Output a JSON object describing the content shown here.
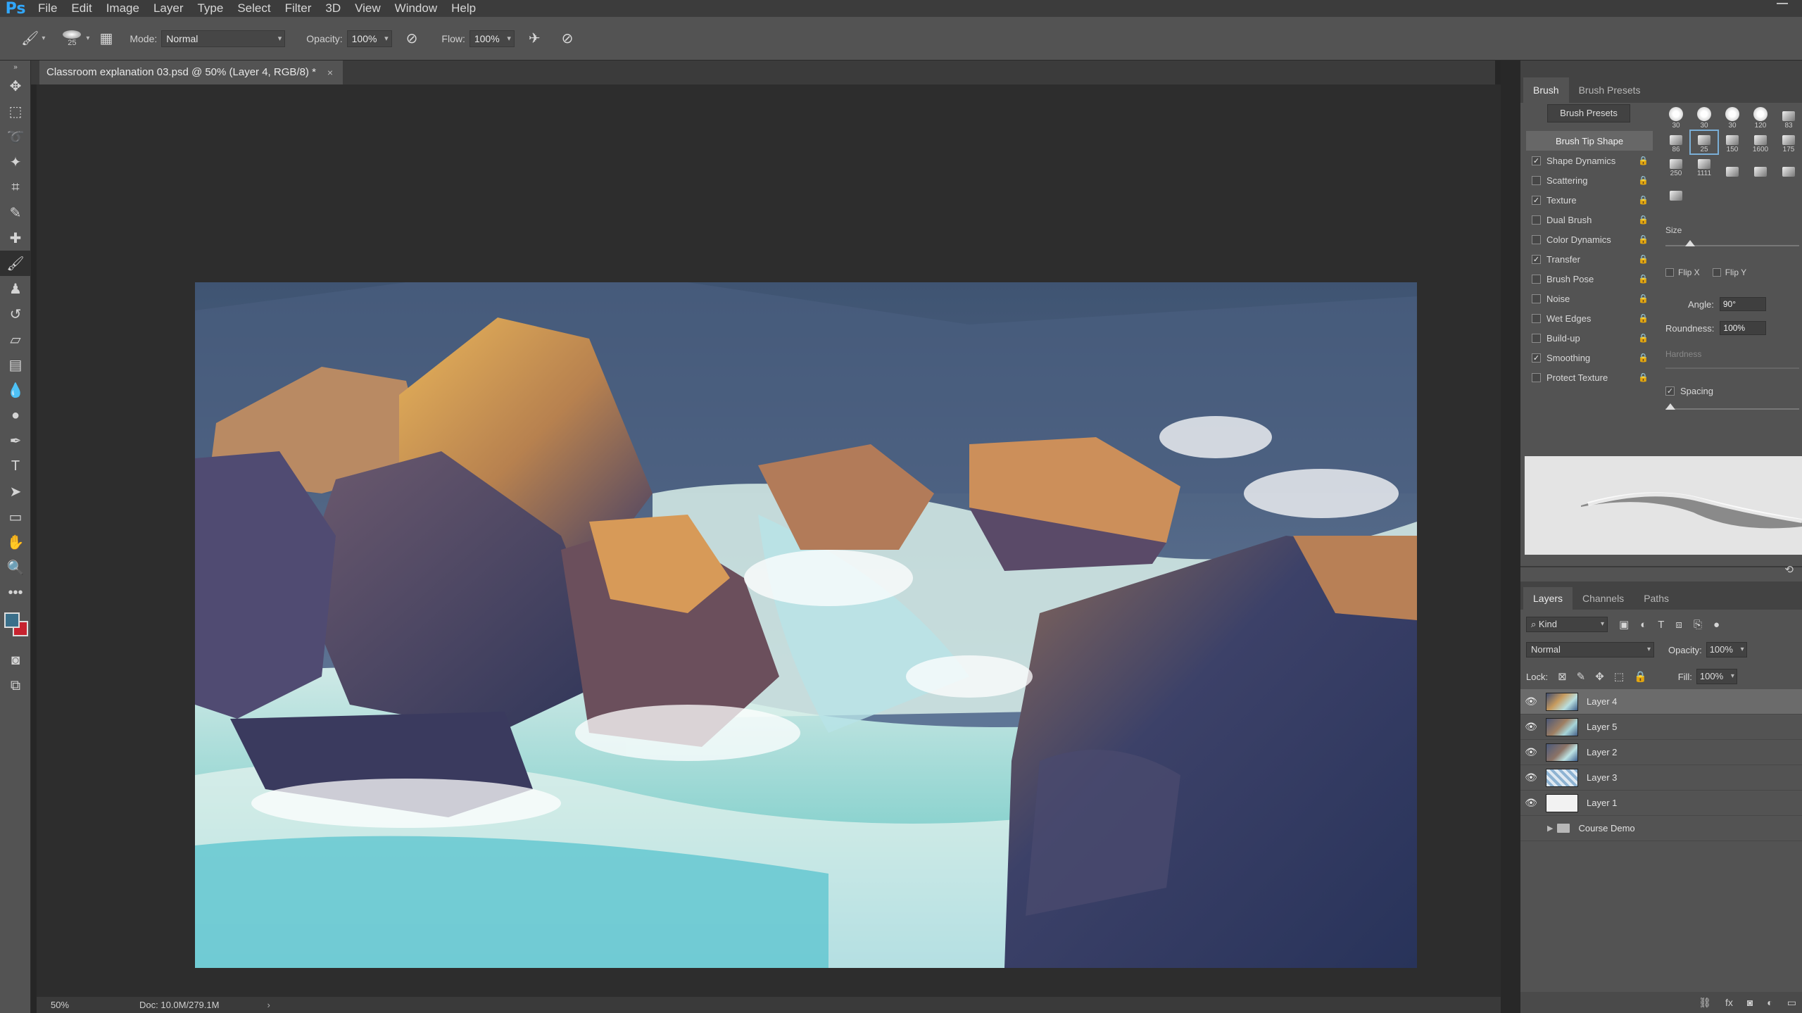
{
  "app": {
    "logo": "Ps",
    "menu": [
      "File",
      "Edit",
      "Image",
      "Layer",
      "Type",
      "Select",
      "Filter",
      "3D",
      "View",
      "Window",
      "Help"
    ]
  },
  "options_bar": {
    "brush_size": "25",
    "mode_label": "Mode:",
    "mode_value": "Normal",
    "opacity_label": "Opacity:",
    "opacity_value": "100%",
    "flow_label": "Flow:",
    "flow_value": "100%"
  },
  "colors": {
    "foreground": "#3a6f8a",
    "background": "#c7232f",
    "accent": "#31a8ff"
  },
  "document": {
    "tab_title": "Classroom explanation 03.psd @ 50% (Layer 4, RGB/8) *",
    "close_glyph": "×"
  },
  "status_bar": {
    "zoom": "50%",
    "doc_info": "Doc: 10.0M/279.1M",
    "arrow": "›"
  },
  "brush_panel": {
    "tabs": [
      "Brush",
      "Brush Presets"
    ],
    "presets_button": "Brush Presets",
    "options": [
      {
        "label": "Brush Tip Shape",
        "head": true
      },
      {
        "label": "Shape Dynamics",
        "checked": true
      },
      {
        "label": "Scattering",
        "checked": false
      },
      {
        "label": "Texture",
        "checked": true
      },
      {
        "label": "Dual Brush",
        "checked": false
      },
      {
        "label": "Color Dynamics",
        "checked": false
      },
      {
        "label": "Transfer",
        "checked": true
      },
      {
        "label": "Brush Pose",
        "checked": false
      },
      {
        "label": "Noise",
        "checked": false
      },
      {
        "label": "Wet Edges",
        "checked": false
      },
      {
        "label": "Build-up",
        "checked": false
      },
      {
        "label": "Smoothing",
        "checked": true
      },
      {
        "label": "Protect Texture",
        "checked": false
      }
    ],
    "tips": [
      "30",
      "30",
      "30",
      "120",
      "83",
      "86",
      "25",
      "150",
      "1600",
      "175",
      "250",
      "1111",
      "",
      "",
      "",
      ""
    ],
    "selected_tip": 6,
    "size_label": "Size",
    "flip_x": "Flip X",
    "flip_y": "Flip Y",
    "angle_label": "Angle:",
    "angle_value": "90°",
    "roundness_label": "Roundness:",
    "roundness_value": "100%",
    "hardness_label": "Hardness",
    "spacing_label": "Spacing"
  },
  "layers_panel": {
    "tabs": [
      "Layers",
      "Channels",
      "Paths"
    ],
    "kind_label": "Kind",
    "blend_mode": "Normal",
    "opacity_label": "Opacity:",
    "opacity_value": "100%",
    "lock_label": "Lock:",
    "fill_label": "Fill:",
    "fill_value": "100%",
    "layers": [
      {
        "name": "Layer 4",
        "selected": true
      },
      {
        "name": "Layer 5",
        "selected": false
      },
      {
        "name": "Layer 2",
        "selected": false
      },
      {
        "name": "Layer 3",
        "selected": false
      },
      {
        "name": "Layer 1",
        "selected": false
      }
    ],
    "group": "Course Demo",
    "footer_fx": "fx"
  }
}
